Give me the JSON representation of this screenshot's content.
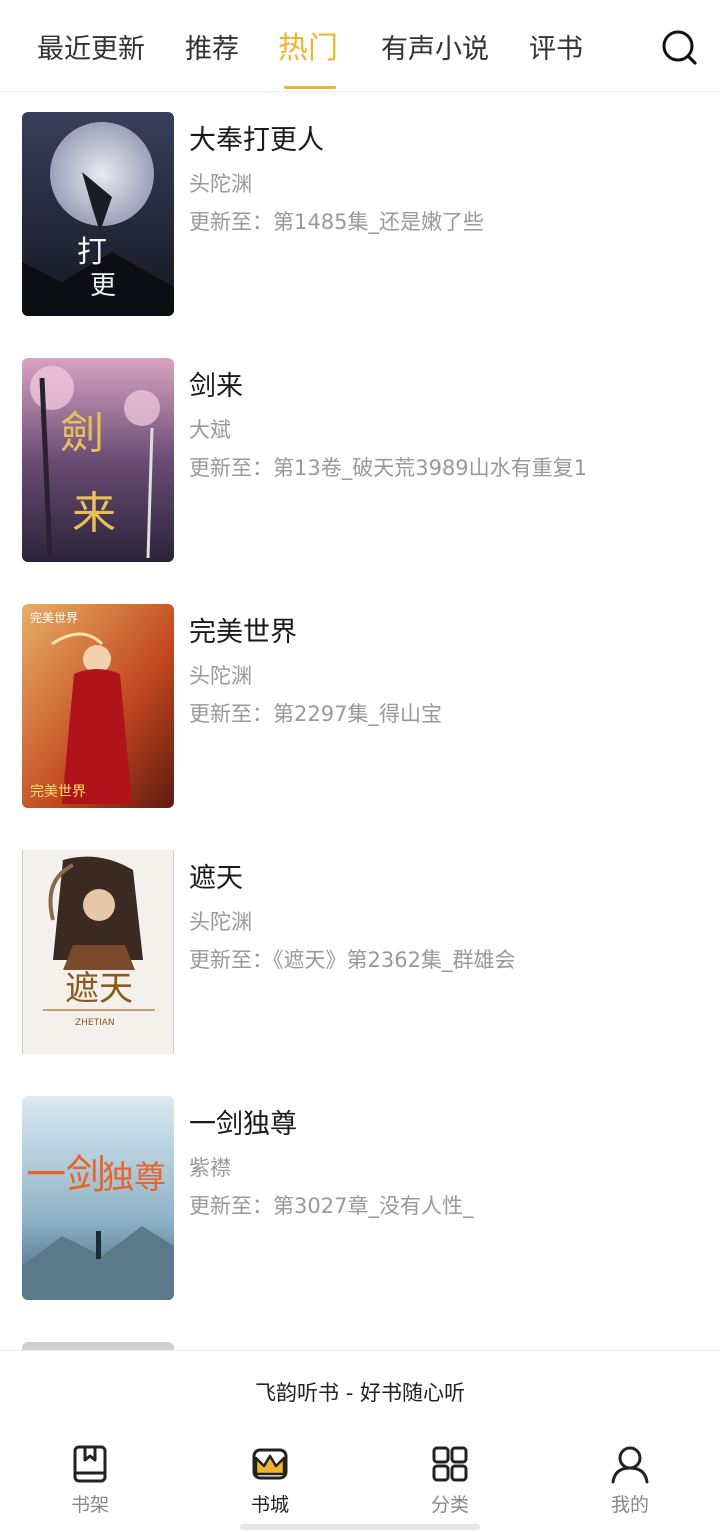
{
  "tabs": [
    {
      "label": "最近更新",
      "active": false
    },
    {
      "label": "推荐",
      "active": false
    },
    {
      "label": "热门",
      "active": true
    },
    {
      "label": "有声小说",
      "active": false
    },
    {
      "label": "评书",
      "active": false
    }
  ],
  "search_icon": "search-icon",
  "accent_color": "#f1b42f",
  "books": [
    {
      "title": "大奉打更人",
      "author": "头陀渊",
      "update": "更新至：第1485集_还是嫩了些"
    },
    {
      "title": "剑来",
      "author": "大斌",
      "update": "更新至：第13卷_破天荒3989山水有重复1"
    },
    {
      "title": "完美世界",
      "author": "头陀渊",
      "update": "更新至：第2297集_得山宝"
    },
    {
      "title": "遮天",
      "author": "头陀渊",
      "update": "更新至：《遮天》第2362集_群雄会"
    },
    {
      "title": "一剑独尊",
      "author": "紫襟",
      "update": "更新至：第3027章_没有人性_"
    }
  ],
  "footer": {
    "slogan": "飞韵听书 - 好书随心听"
  },
  "bottom_nav": [
    {
      "label": "书架",
      "icon": "bookshelf-icon",
      "active": false
    },
    {
      "label": "书城",
      "icon": "bookstore-icon",
      "active": true
    },
    {
      "label": "分类",
      "icon": "category-grid-icon",
      "active": false
    },
    {
      "label": "我的",
      "icon": "profile-icon",
      "active": false
    }
  ]
}
